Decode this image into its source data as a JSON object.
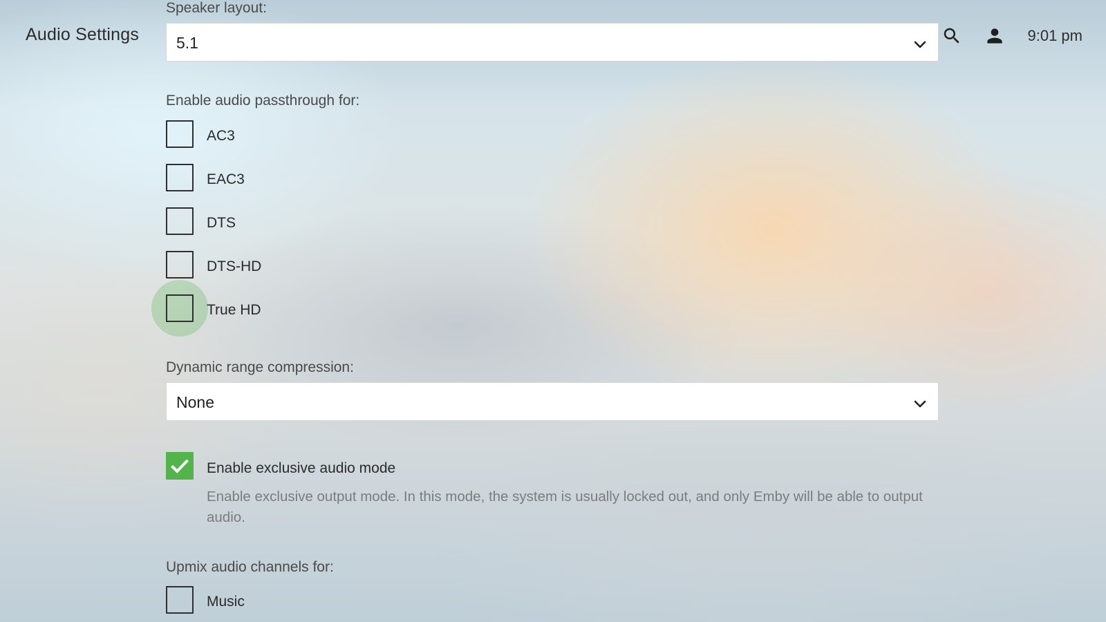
{
  "header": {
    "title": "Audio Settings",
    "time": "9:01 pm",
    "search_icon": "search-icon",
    "user_icon": "user-icon"
  },
  "speaker_layout": {
    "label": "Speaker layout:",
    "value": "5.1"
  },
  "passthrough": {
    "label": "Enable audio passthrough for:",
    "items": [
      {
        "label": "AC3",
        "checked": false
      },
      {
        "label": "EAC3",
        "checked": false
      },
      {
        "label": "DTS",
        "checked": false
      },
      {
        "label": "DTS-HD",
        "checked": false
      },
      {
        "label": "True HD",
        "checked": false,
        "focused": true
      }
    ]
  },
  "drc": {
    "label": "Dynamic range compression:",
    "value": "None"
  },
  "exclusive_mode": {
    "label": "Enable exclusive audio mode",
    "checked": true,
    "description": "Enable exclusive output mode. In this mode, the system is usually locked out, and only Emby will be able to output audio."
  },
  "upmix": {
    "label": "Upmix audio channels for:",
    "items": [
      {
        "label": "Music",
        "checked": false
      }
    ]
  },
  "colors": {
    "accent": "#52b54b",
    "focus": "#b9dcb2"
  }
}
